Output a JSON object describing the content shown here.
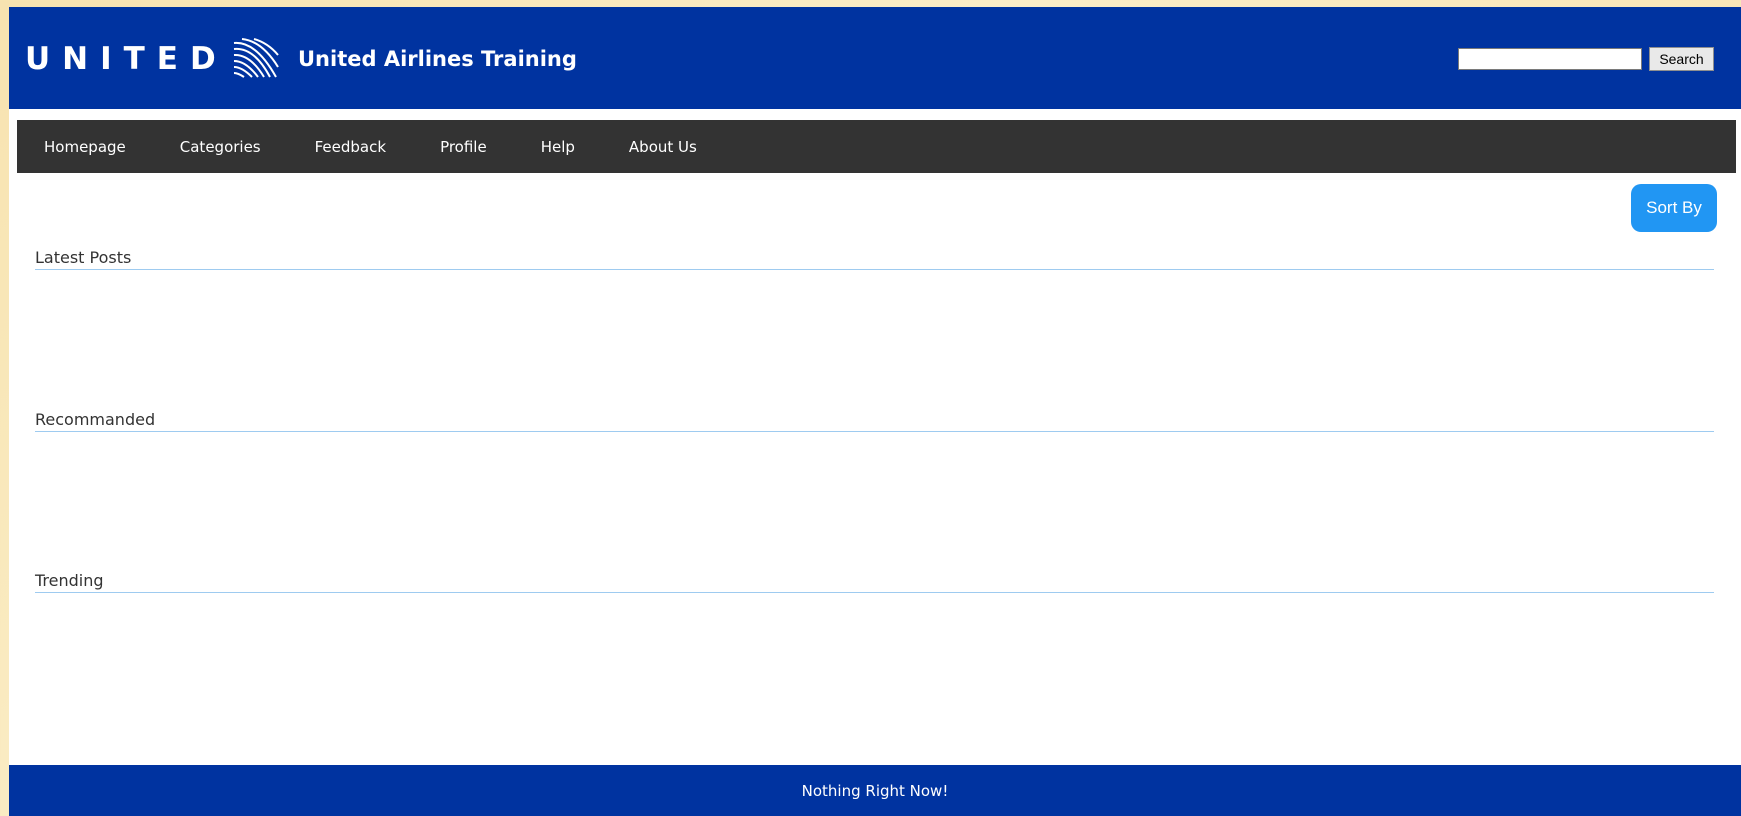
{
  "header": {
    "brand_word": "UNITED",
    "site_title": "United Airlines Training",
    "search_placeholder": "",
    "search_button": "Search"
  },
  "nav": {
    "items": [
      "Homepage",
      "Categories",
      "Feedback",
      "Profile",
      "Help",
      "About Us"
    ]
  },
  "main": {
    "sort_label": "Sort By",
    "sections": [
      "Latest Posts",
      "Recommanded",
      "Trending"
    ]
  },
  "footer": {
    "text": "Nothing Right Now!"
  },
  "colors": {
    "header_blue": "#0033a0",
    "nav_dark": "#333333",
    "accent_blue": "#2196f3",
    "section_rule": "#9ecbf0"
  }
}
